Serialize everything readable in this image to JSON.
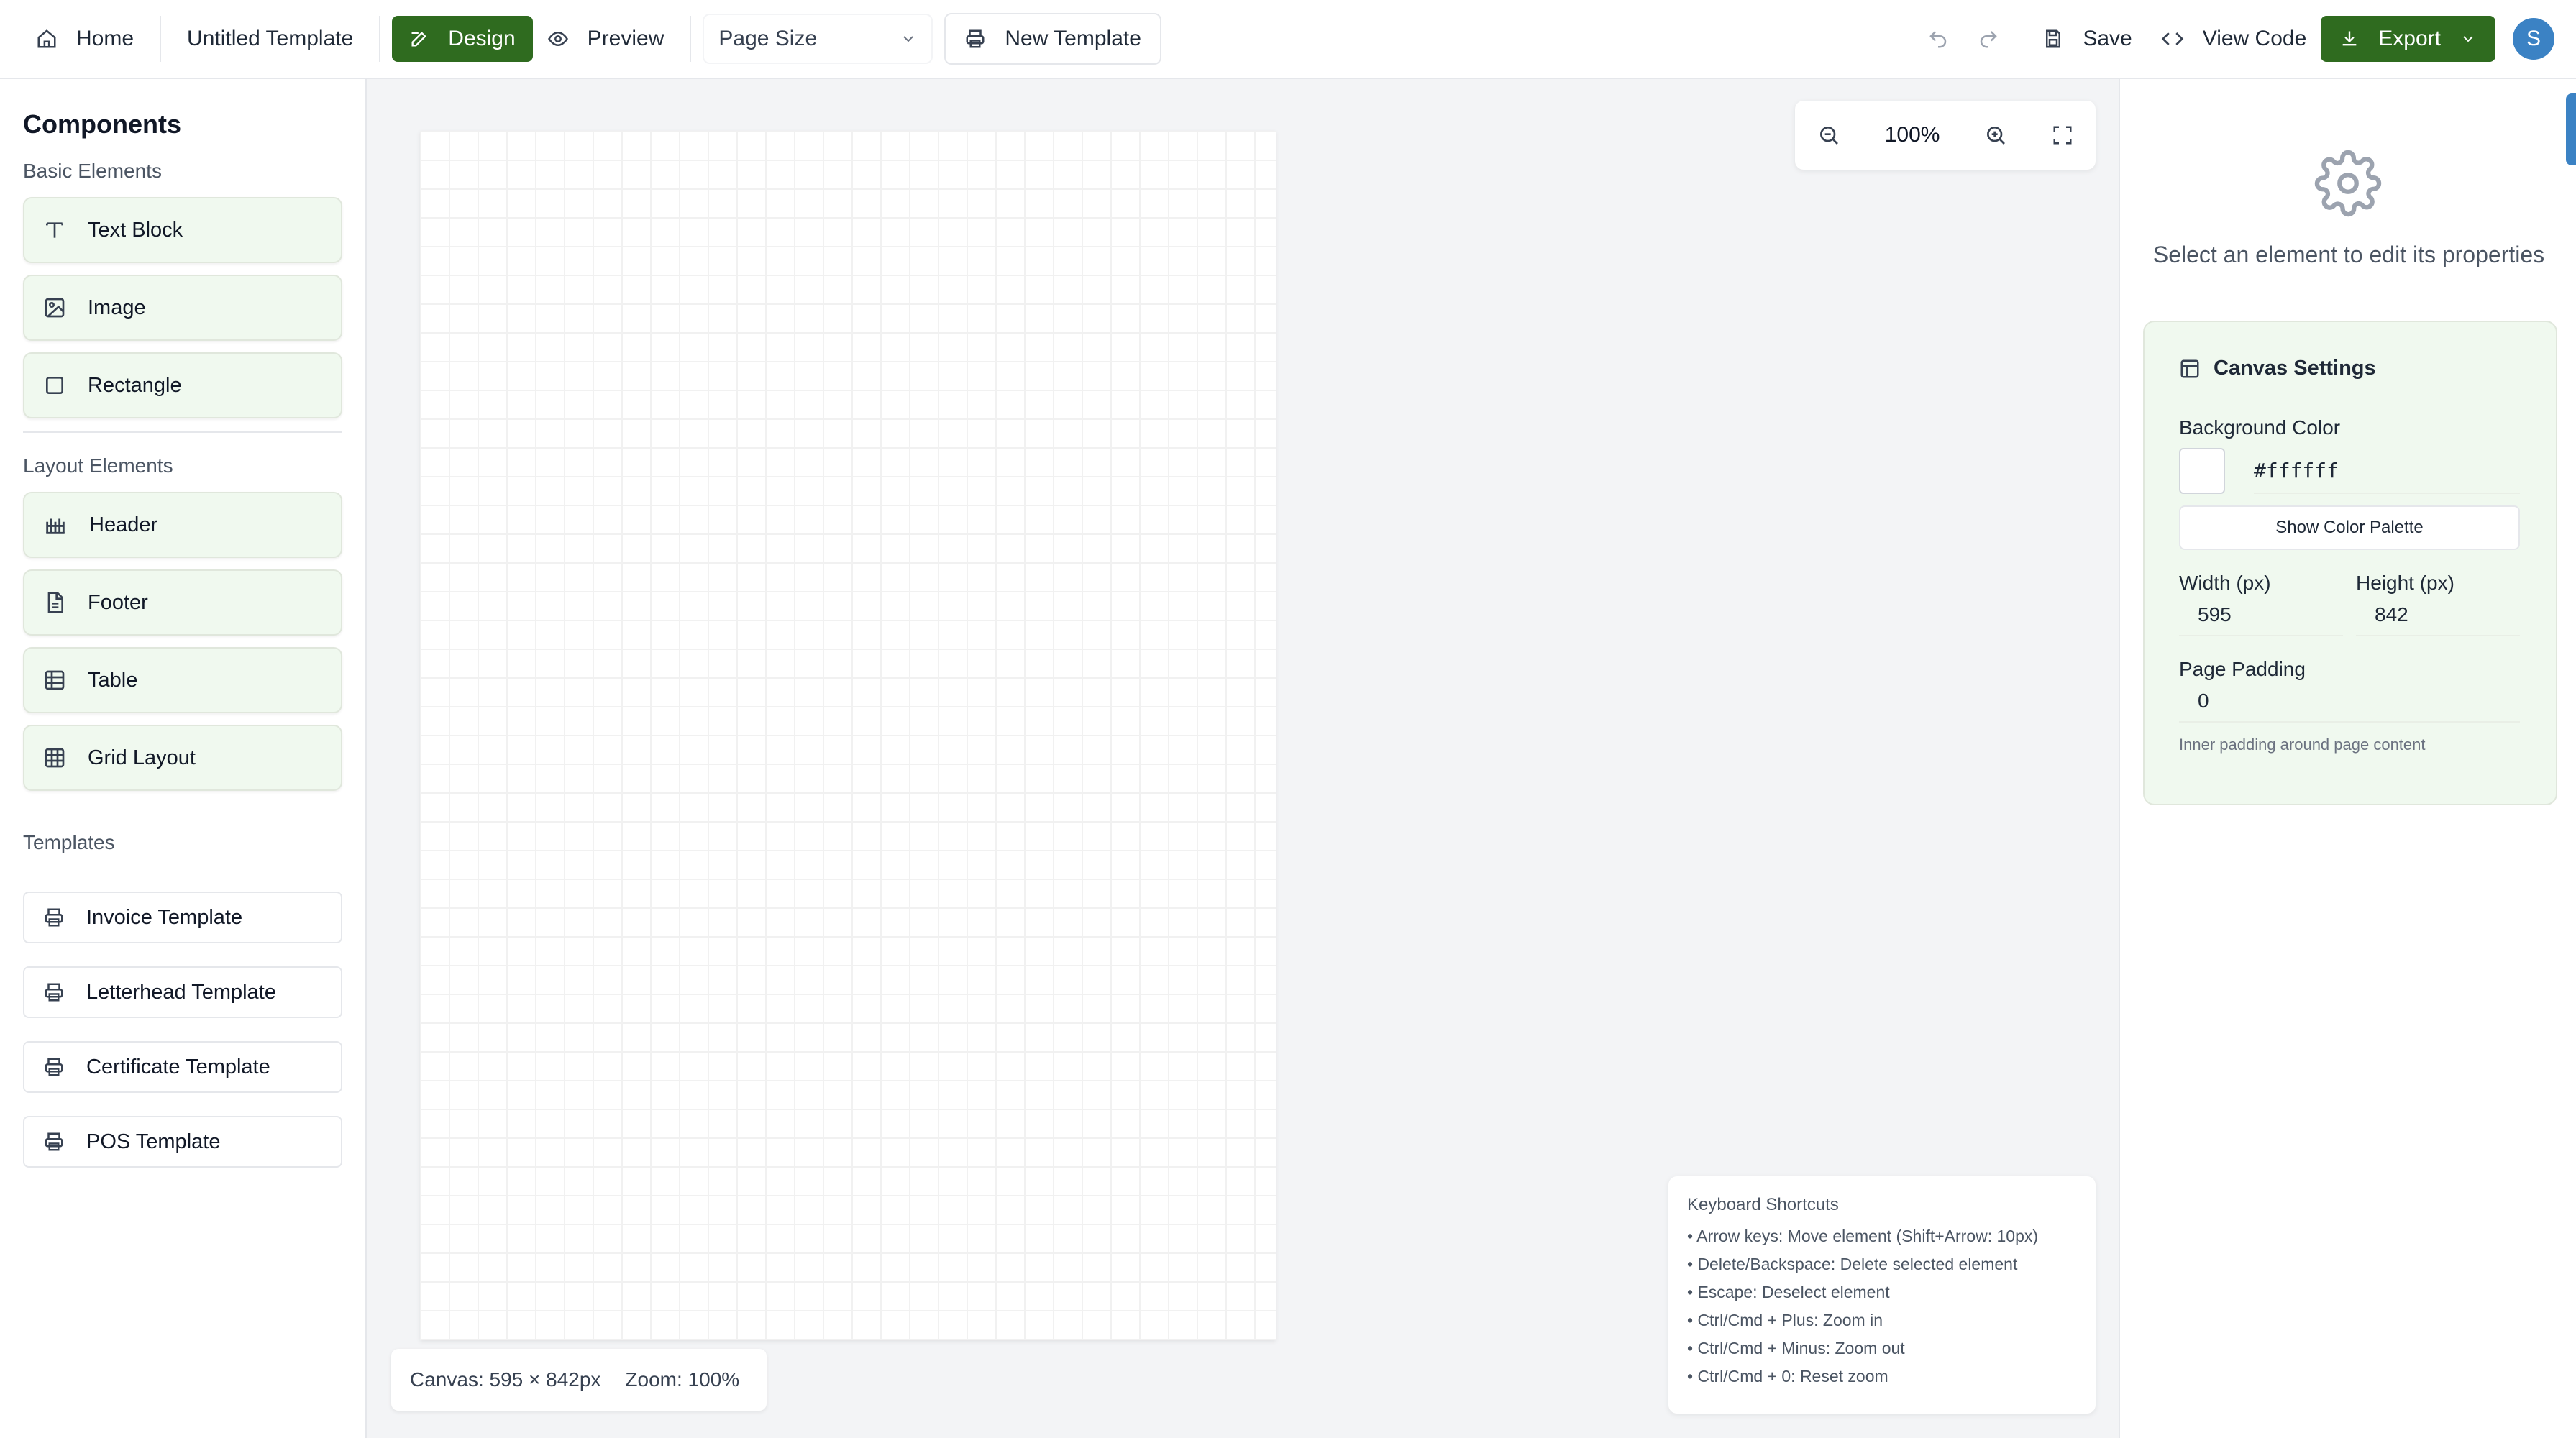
{
  "topbar": {
    "home_label": "Home",
    "template_name": "Untitled Template",
    "design_label": "Design",
    "preview_label": "Preview",
    "page_size_label": "Page Size",
    "new_template_label": "New Template",
    "save_label": "Save",
    "view_code_label": "View Code",
    "export_label": "Export",
    "avatar_initial": "S"
  },
  "sidebar": {
    "title": "Components",
    "basic_title": "Basic Elements",
    "basic_items": [
      "Text Block",
      "Image",
      "Rectangle"
    ],
    "layout_title": "Layout Elements",
    "layout_items": [
      "Header",
      "Footer",
      "Table",
      "Grid Layout"
    ],
    "templates_title": "Templates",
    "templates": [
      "Invoice Template",
      "Letterhead Template",
      "Certificate Template",
      "POS Template"
    ]
  },
  "canvas": {
    "zoom_value": "100%",
    "status_size": "Canvas: 595 × 842px",
    "status_zoom": "Zoom: 100%"
  },
  "shortcuts": {
    "title": "Keyboard Shortcuts",
    "lines": [
      "• Arrow keys: Move element (Shift+Arrow: 10px)",
      "• Delete/Backspace: Delete selected element",
      "• Escape: Deselect element",
      "• Ctrl/Cmd + Plus: Zoom in",
      "• Ctrl/Cmd + Minus: Zoom out",
      "• Ctrl/Cmd + 0: Reset zoom"
    ]
  },
  "properties": {
    "hint": "Select an element to edit its properties",
    "settings_title": "Canvas Settings",
    "bg_label": "Background Color",
    "bg_value": "#ffffff",
    "palette_label": "Show Color Palette",
    "width_label": "Width (px)",
    "width_value": "595",
    "height_label": "Height (px)",
    "height_value": "842",
    "padding_label": "Page Padding",
    "padding_value": "0",
    "padding_help": "Inner padding around page content"
  },
  "colors": {
    "accent": "#2f6b1f",
    "panel_tint": "#f0f9ef",
    "avatar": "#3b82c4"
  }
}
